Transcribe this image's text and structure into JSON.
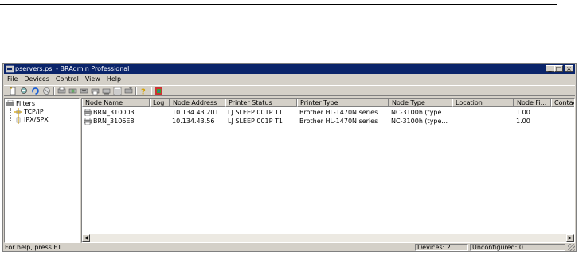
{
  "window": {
    "title": "pservers.psl - BRAdmin Professional",
    "title_color": "#0a246a",
    "controls": [
      "_",
      "□",
      "×"
    ]
  },
  "menu": [
    "File",
    "Devices",
    "Control",
    "View",
    "Help"
  ],
  "toolbar": {
    "icons": [
      "new-icon",
      "search-devices-icon",
      "refresh-icon",
      "stop-icon",
      "configure-icon",
      "web-config-icon",
      "load-firmware-icon",
      "send-file-icon",
      "view-icon",
      "list-icon",
      "filter-icon",
      "help-icon",
      "about-icon"
    ]
  },
  "tree": {
    "root": "Filters",
    "children": [
      "TCP/IP",
      "IPX/SPX"
    ]
  },
  "table": {
    "columns": [
      "Node Name",
      "Log",
      "Node Address",
      "Printer Status",
      "Printer Type",
      "Node Type",
      "Location",
      "Node Fi...",
      "Contac"
    ],
    "rows": [
      [
        "BRN_310003",
        "",
        "10.134.43.201",
        "LJ SLEEP 001P T1",
        "Brother HL-1470N series",
        "NC-3100h (type...",
        "",
        "1.00",
        ""
      ],
      [
        "BRN_3106E8",
        "",
        "10.134.43.56",
        "LJ SLEEP 001P T1",
        "Brother HL-1470N series",
        "NC-3100h (type...",
        "",
        "1.00",
        ""
      ]
    ]
  },
  "status": {
    "help": "For help, press F1",
    "devices": "Devices: 2",
    "unconfigured": "Unconfigured: 0"
  }
}
